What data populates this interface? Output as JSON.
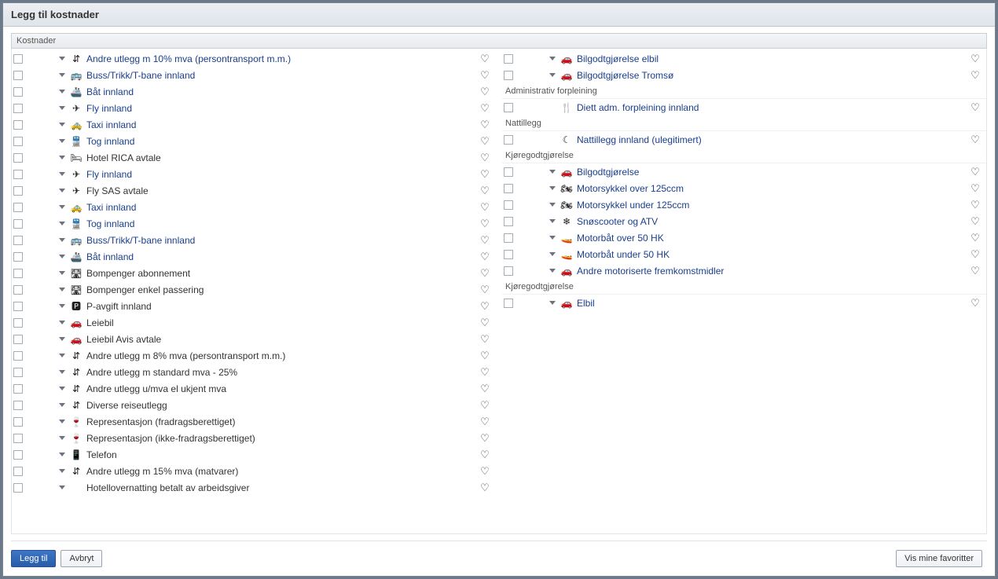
{
  "title": "Legg til kostnader",
  "section_header": "Kostnader",
  "buttons": {
    "add": "Legg til",
    "cancel": "Avbryt",
    "show_fav": "Vis mine favoritter"
  },
  "icons": {
    "misc": "⇵",
    "bus": "🚌",
    "boat": "🚢",
    "plane": "✈",
    "taxi": "🚕",
    "train": "🚆",
    "hotel": "🛏",
    "toll": "🛣",
    "parking": "🅿",
    "car": "🚗",
    "wine": "🍷",
    "phone": "📱",
    "meal": "🍴",
    "moon": "☾",
    "motorcycle": "🏍",
    "snow": "❄",
    "motorboat": "🚤",
    "none": ""
  },
  "left": [
    {
      "icon": "misc",
      "label": "Andre utlegg m 10% mva (persontransport m.m.)",
      "hl": true
    },
    {
      "icon": "bus",
      "label": "Buss/Trikk/T-bane innland",
      "hl": true
    },
    {
      "icon": "boat",
      "label": "Båt innland",
      "hl": true
    },
    {
      "icon": "plane",
      "label": "Fly innland",
      "hl": true
    },
    {
      "icon": "taxi",
      "label": "Taxi innland",
      "hl": true
    },
    {
      "icon": "train",
      "label": "Tog innland",
      "hl": true
    },
    {
      "icon": "hotel",
      "label": "Hotel RICA avtale"
    },
    {
      "icon": "plane",
      "label": "Fly innland",
      "hl": true
    },
    {
      "icon": "plane",
      "label": "Fly SAS avtale"
    },
    {
      "icon": "taxi",
      "label": "Taxi innland",
      "hl": true
    },
    {
      "icon": "train",
      "label": "Tog innland",
      "hl": true
    },
    {
      "icon": "bus",
      "label": "Buss/Trikk/T-bane innland",
      "hl": true
    },
    {
      "icon": "boat",
      "label": "Båt innland",
      "hl": true
    },
    {
      "icon": "toll",
      "label": "Bompenger abonnement"
    },
    {
      "icon": "toll",
      "label": "Bompenger enkel passering"
    },
    {
      "icon": "parking",
      "label": "P-avgift innland"
    },
    {
      "icon": "car",
      "label": "Leiebil"
    },
    {
      "icon": "car",
      "label": "Leiebil Avis avtale"
    },
    {
      "icon": "misc",
      "label": "Andre utlegg m 8% mva (persontransport m.m.)"
    },
    {
      "icon": "misc",
      "label": "Andre utlegg m standard mva - 25%"
    },
    {
      "icon": "misc",
      "label": "Andre utlegg u/mva el ukjent mva"
    },
    {
      "icon": "misc",
      "label": "Diverse reiseutlegg"
    },
    {
      "icon": "wine",
      "label": "Representasjon (fradragsberettiget)"
    },
    {
      "icon": "wine",
      "label": "Representasjon (ikke-fradragsberettiget)"
    },
    {
      "icon": "phone",
      "label": "Telefon"
    },
    {
      "icon": "misc",
      "label": "Andre utlegg m 15% mva (matvarer)"
    },
    {
      "icon": "none",
      "label": "Hotellovernatting betalt av arbeidsgiver"
    }
  ],
  "right": [
    {
      "type": "row",
      "icon": "car",
      "label": "Bilgodtgjørelse elbil",
      "hl": true
    },
    {
      "type": "row",
      "icon": "car",
      "label": "Bilgodtgjørelse Tromsø",
      "hl": true
    },
    {
      "type": "header",
      "label": "Administrativ forpleining"
    },
    {
      "type": "row",
      "icon": "meal",
      "label": "Diett adm. forpleining innland",
      "hl": true,
      "nochev": true
    },
    {
      "type": "header",
      "label": "Nattillegg"
    },
    {
      "type": "row",
      "icon": "moon",
      "label": "Nattillegg innland (ulegitimert)",
      "hl": true,
      "nochev": true
    },
    {
      "type": "header",
      "label": "Kjøregodtgjørelse"
    },
    {
      "type": "row",
      "icon": "car",
      "label": "Bilgodtgjørelse",
      "hl": true
    },
    {
      "type": "row",
      "icon": "motorcycle",
      "label": "Motorsykkel over 125ccm",
      "hl": true
    },
    {
      "type": "row",
      "icon": "motorcycle",
      "label": "Motorsykkel under 125ccm",
      "hl": true
    },
    {
      "type": "row",
      "icon": "snow",
      "label": "Snøscooter og ATV",
      "hl": true
    },
    {
      "type": "row",
      "icon": "motorboat",
      "label": "Motorbåt over 50 HK",
      "hl": true
    },
    {
      "type": "row",
      "icon": "motorboat",
      "label": "Motorbåt under 50 HK",
      "hl": true
    },
    {
      "type": "row",
      "icon": "car",
      "label": "Andre motoriserte fremkomstmidler",
      "hl": true
    },
    {
      "type": "header",
      "label": "Kjøregodtgjørelse"
    },
    {
      "type": "row",
      "icon": "car",
      "label": "Elbil",
      "hl": true
    }
  ]
}
